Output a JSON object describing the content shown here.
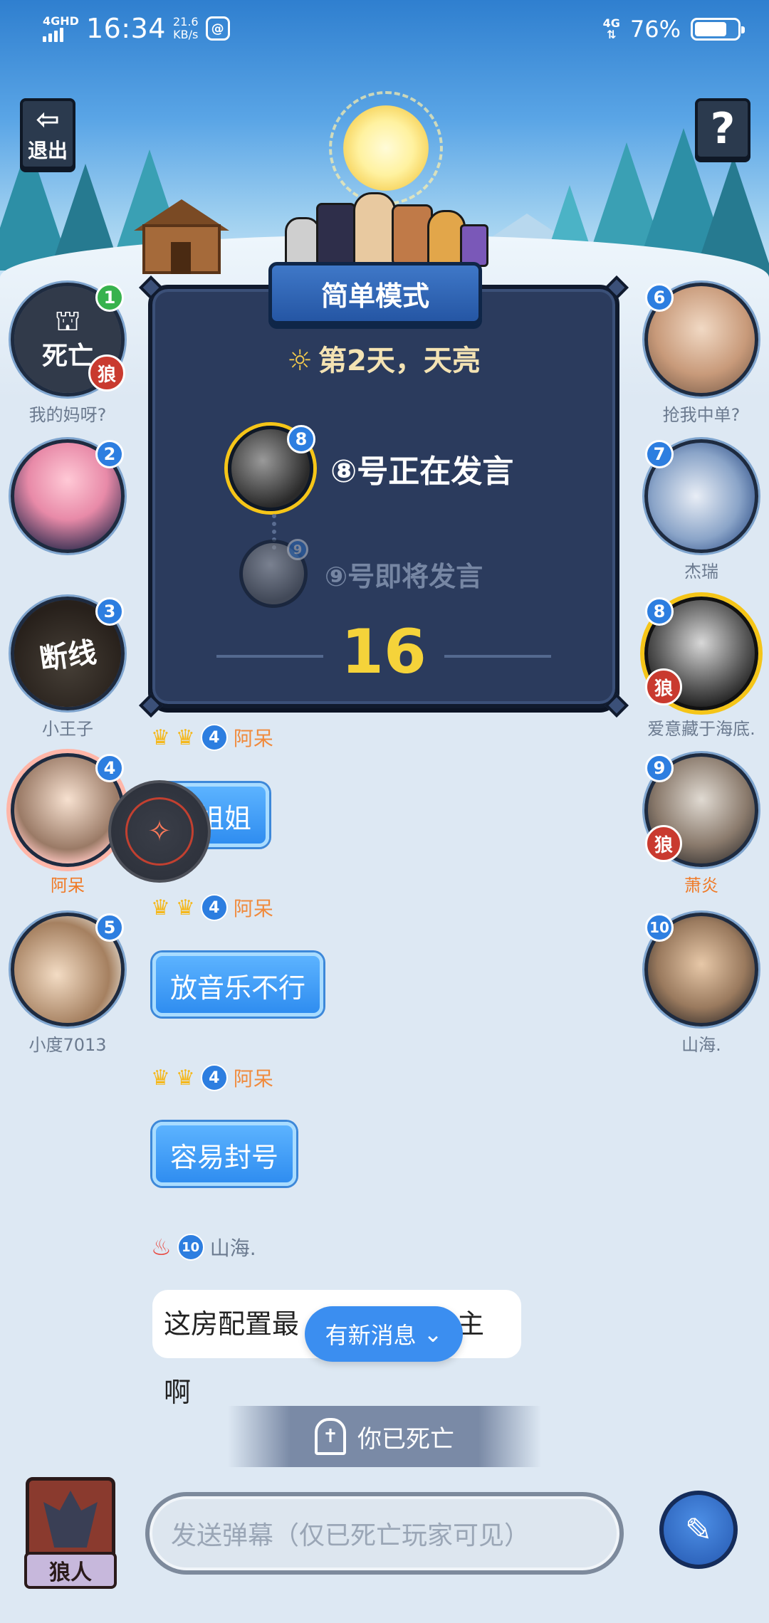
{
  "status_bar": {
    "network_left": "4GHD",
    "time": "16:34",
    "speed_value": "21.6",
    "speed_unit": "KB/s",
    "app_icon": "@",
    "network_right": "4G",
    "battery": "76%",
    "battery_level": 0.76
  },
  "top": {
    "exit_label": "退出",
    "help_label": "?"
  },
  "board": {
    "mode": "简单模式",
    "day_status": "第2天，天亮",
    "current_speaker_num": "8",
    "current_speaker_text": "⑧号正在发言",
    "next_speaker_num": "9",
    "next_speaker_text": "⑨号即将发言",
    "timer": "16"
  },
  "players": {
    "p1": {
      "num": "1",
      "name": "我的妈呀?",
      "overlay": "死亡",
      "tag": "狼"
    },
    "p2": {
      "num": "2",
      "name": ""
    },
    "p3": {
      "num": "3",
      "name": "小王子",
      "overlay": "断线"
    },
    "p4": {
      "num": "4",
      "name": "阿呆"
    },
    "p5": {
      "num": "5",
      "name": "小度7013"
    },
    "p6": {
      "num": "6",
      "name": "抢我中单?"
    },
    "p7": {
      "num": "7",
      "name": "杰瑞"
    },
    "p8": {
      "num": "8",
      "name": "爱意藏于海底.",
      "tag": "狼"
    },
    "p9": {
      "num": "9",
      "name": "",
      "tag": "狼"
    },
    "p9_name": "萧炎",
    "p10": {
      "num": "10",
      "name": "山海."
    }
  },
  "chat": {
    "messages": [
      {
        "sender": "阿呆",
        "level": "4",
        "text": "小姐姐"
      },
      {
        "sender": "阿呆",
        "level": "4",
        "text": "放音乐不行"
      },
      {
        "sender": "阿呆",
        "level": "4",
        "text": "容易封号"
      },
      {
        "sender": "山海.",
        "level": "10",
        "text": "这房配置最",
        "text_tail": "主啊"
      }
    ],
    "new_messages_label": "有新消息"
  },
  "footer": {
    "dead_banner": "你已死亡",
    "role_label": "狼人",
    "input_placeholder": "发送弹幕（仅已死亡玩家可见）"
  }
}
